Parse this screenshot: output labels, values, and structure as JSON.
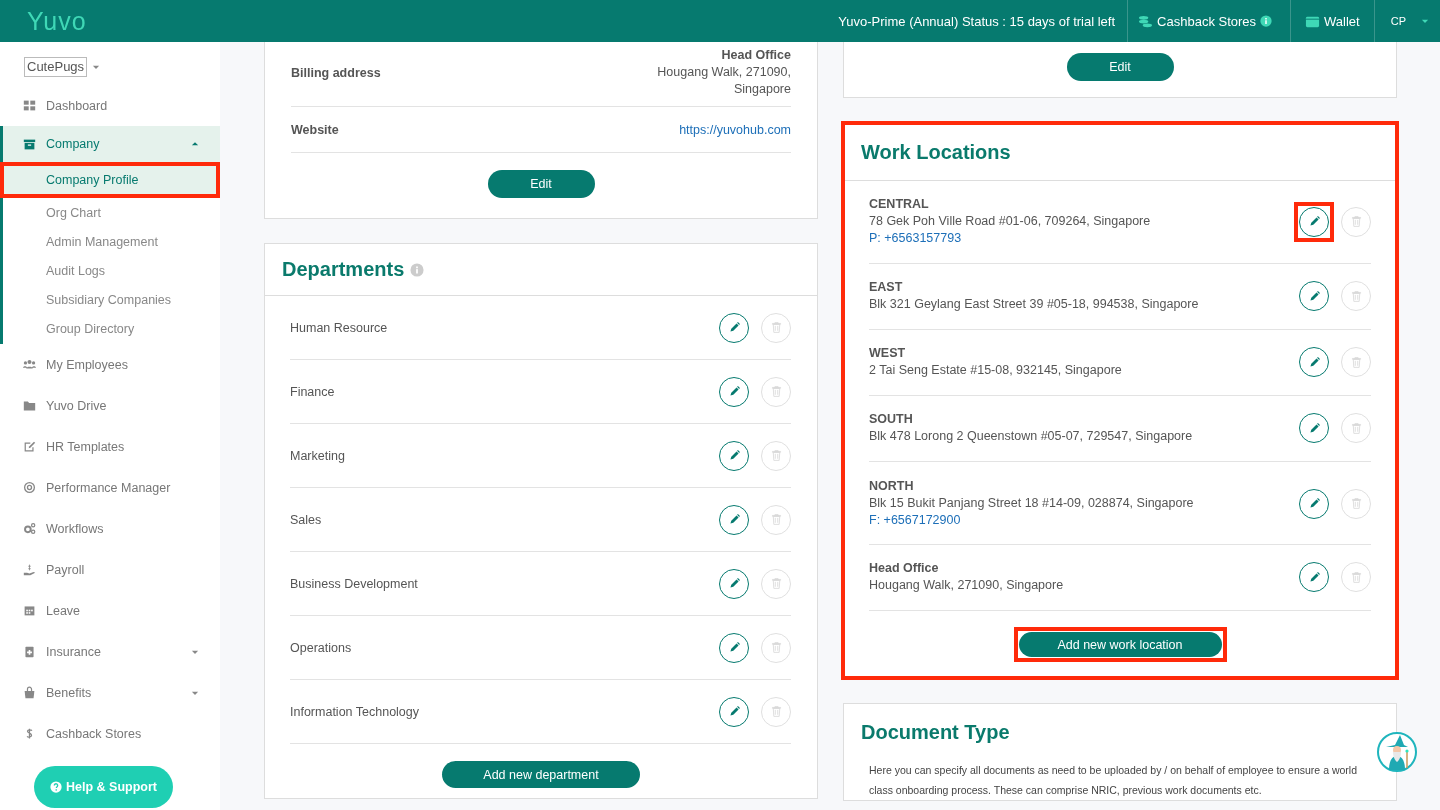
{
  "topbar": {
    "logo": "Yuvo",
    "status": "Yuvo-Prime (Annual) Status : 15 days of trial left",
    "links": [
      {
        "label": "Cashback Stores",
        "kind": "cashback"
      },
      {
        "label": "Wallet",
        "kind": "wallet"
      }
    ],
    "user": "CP"
  },
  "sidebar": {
    "org_selector": "CutePugs",
    "items": [
      {
        "label": "Dashboard"
      },
      {
        "label": "Company",
        "expanded": true,
        "children": [
          {
            "label": "Company Profile",
            "selected": true,
            "highlighted": true
          },
          {
            "label": "Org Chart",
            "selected": false,
            "highlighted": false
          },
          {
            "label": "Admin Management",
            "selected": false,
            "highlighted": false
          },
          {
            "label": "Audit Logs",
            "selected": false,
            "highlighted": false
          },
          {
            "label": "Subsidiary Companies",
            "selected": false,
            "highlighted": false
          },
          {
            "label": "Group Directory",
            "selected": false,
            "highlighted": false
          }
        ]
      },
      {
        "label": "My Employees"
      },
      {
        "label": "Yuvo Drive"
      },
      {
        "label": "HR Templates"
      },
      {
        "label": "Performance Manager"
      },
      {
        "label": "Workflows"
      },
      {
        "label": "Payroll"
      },
      {
        "label": "Leave"
      },
      {
        "label": "Insurance",
        "expanded": false
      },
      {
        "label": "Benefits",
        "expanded": false
      },
      {
        "label": "Cashback Stores"
      }
    ],
    "help_button": "Help & Support"
  },
  "company_card": {
    "fields": [
      {
        "label": "Billing address",
        "kind": "address",
        "heading": "Head Office",
        "lines": [
          "Hougang Walk, 271090,",
          "Singapore"
        ]
      },
      {
        "label": "Website",
        "kind": "link",
        "value": "https://yuvohub.com"
      }
    ],
    "edit_button": "Edit"
  },
  "departments": {
    "title": "Departments",
    "items": [
      {
        "name": "Human Resource",
        "delete_disabled": true
      },
      {
        "name": "Finance",
        "delete_disabled": true
      },
      {
        "name": "Marketing",
        "delete_disabled": true
      },
      {
        "name": "Sales",
        "delete_disabled": true
      },
      {
        "name": "Business Development",
        "delete_disabled": true
      },
      {
        "name": "Operations",
        "delete_disabled": true
      },
      {
        "name": "Information Technology",
        "delete_disabled": true
      }
    ],
    "add_button": "Add new department"
  },
  "top_right_card": {
    "edit_button": "Edit"
  },
  "work_locations": {
    "title": "Work Locations",
    "highlighted": true,
    "items": [
      {
        "name": "CENTRAL",
        "address": "78 Gek Poh Ville Road #01-06, 709264, Singapore",
        "phone": "P: +6563157793",
        "edit_highlighted": true,
        "delete_disabled": true
      },
      {
        "name": "EAST",
        "address": "Blk 321 Geylang East Street 39 #05-18, 994538, Singapore",
        "edit_highlighted": false,
        "delete_disabled": true
      },
      {
        "name": "WEST",
        "address": "2 Tai Seng Estate #15-08, 932145, Singapore",
        "edit_highlighted": false,
        "delete_disabled": true
      },
      {
        "name": "SOUTH",
        "address": "Blk 478 Lorong 2 Queenstown #05-07, 729547, Singapore",
        "edit_highlighted": false,
        "delete_disabled": true
      },
      {
        "name": "NORTH",
        "address": "Blk 15 Bukit Panjang Street 18 #14-09, 028874, Singapore",
        "phone": "F: +6567172900",
        "edit_highlighted": false,
        "delete_disabled": true
      },
      {
        "name": "Head Office",
        "address": "Hougang Walk, 271090, Singapore",
        "edit_highlighted": false,
        "delete_disabled": true
      }
    ],
    "add_button": {
      "label": "Add new work location",
      "highlighted": true
    }
  },
  "document_type": {
    "title": "Document Type",
    "description": "Here you can specify all documents as need to be uploaded by / on behalf of employee to ensure a world class onboarding process. These can comprise NRIC, previous work documents etc."
  }
}
